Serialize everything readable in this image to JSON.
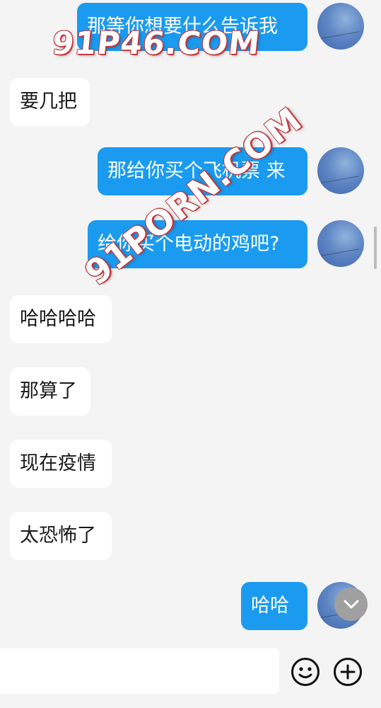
{
  "messages": [
    {
      "side": "out",
      "text": "那等你想要什么告诉我"
    },
    {
      "side": "in",
      "text": "要几把"
    },
    {
      "side": "out",
      "text": "那给你买个飞机票 来"
    },
    {
      "side": "out",
      "text": "给你买个电动的鸡吧?"
    },
    {
      "side": "in",
      "text": "哈哈哈哈"
    },
    {
      "side": "in",
      "text": "那算了"
    },
    {
      "side": "in",
      "text": "现在疫情"
    },
    {
      "side": "in",
      "text": "太恐怖了"
    },
    {
      "side": "out",
      "text": "哈哈"
    }
  ],
  "watermarks": [
    "91P46.COM",
    "91PORN.COM"
  ],
  "input": {
    "placeholder": "",
    "value": ""
  },
  "icons": {
    "emoji": "smiley-icon",
    "plus": "plus-circle-icon",
    "scroll": "chevron-down-icon",
    "avatar": "sky-avatar"
  },
  "colors": {
    "outgoing_bubble": "#1a9bf0",
    "incoming_bubble": "#ffffff",
    "background": "#f4f4f4"
  }
}
